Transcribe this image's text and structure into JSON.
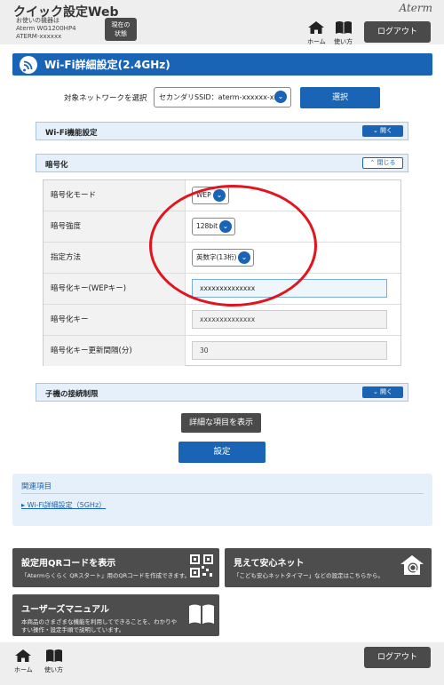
{
  "header": {
    "app_title": "クイック設定Web",
    "device_info": [
      "お使いの機器は",
      "Aterm WG1200HP4",
      "ATERM-xxxxxx"
    ],
    "status_button": [
      "現在の",
      "状態"
    ],
    "brand": "Aterm",
    "home_label": "ホーム",
    "help_label": "使い方",
    "logout_label": "ログアウト"
  },
  "page": {
    "title": "Wi-Fi詳細設定(2.4GHz)",
    "network_label": "対象ネットワークを選択",
    "network_value": "セカンダリSSID：aterm-xxxxxx-xx",
    "select_button": "選択"
  },
  "sections": {
    "wifi_function": {
      "title": "Wi-Fi機能設定",
      "toggle": "開く"
    },
    "encryption": {
      "title": "暗号化",
      "toggle": "閉じる"
    },
    "child_restriction": {
      "title": "子機の接続制限",
      "toggle": "開く"
    }
  },
  "encryption_rows": [
    {
      "label": "暗号化モード",
      "value": "WEP"
    },
    {
      "label": "暗号強度",
      "value": "128bit"
    },
    {
      "label": "指定方法",
      "value": "英数字(13桁)"
    },
    {
      "label": "暗号化キー(WEPキー)",
      "value": "xxxxxxxxxxxxxx"
    },
    {
      "label": "暗号化キー",
      "value": "xxxxxxxxxxxxxx"
    },
    {
      "label": "暗号化キー更新間隔(分)",
      "value": "30"
    }
  ],
  "actions": {
    "show_details": "詳細な項目を表示",
    "apply": "設定"
  },
  "related": {
    "title": "関連項目",
    "link": "Wi-Fi詳細設定（5GHz）"
  },
  "tiles": [
    {
      "title": "設定用QRコードを表示",
      "desc": "「Atermらくらく QRスタート」用のQRコードを作成できます。",
      "icon": "qr-code-icon"
    },
    {
      "title": "見えて安心ネット",
      "desc": "「こども安心ネットタイマー」などの設定はこちらから。",
      "icon": "home-search-icon"
    },
    {
      "title": "ユーザーズマニュアル",
      "desc": "本商品のさまざまな機能を利用してできることを、わかりやすい操作・設定手順で説明しています。",
      "icon": "book-icon"
    }
  ],
  "colors": {
    "accent": "#1a64b5",
    "highlight": "#e0151d",
    "dark_button": "#4a4a4a"
  }
}
